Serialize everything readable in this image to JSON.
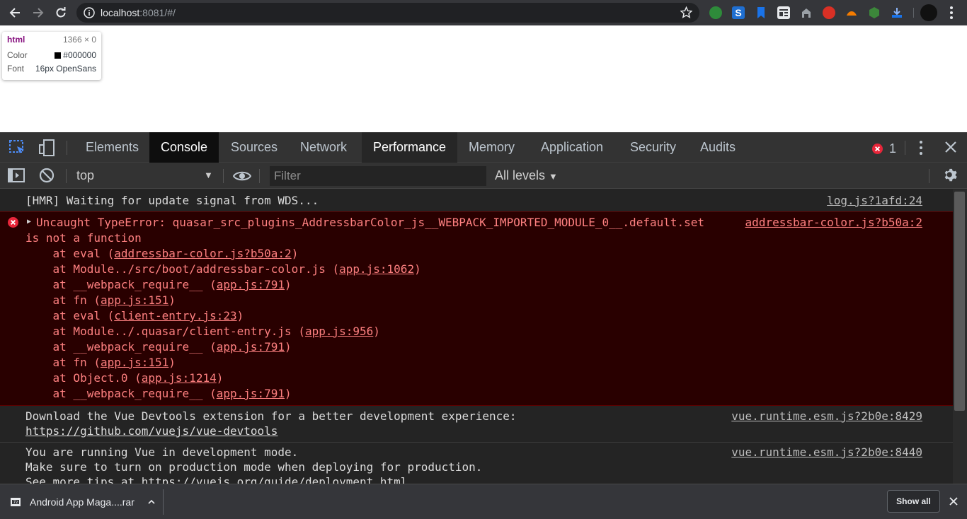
{
  "browser": {
    "url_host": "localhost",
    "url_rest": ":8081/#/"
  },
  "tooltip": {
    "tag": "html",
    "size": "1366 × 0",
    "color_label": "Color",
    "color_value": "#000000",
    "font_label": "Font",
    "font_value": "16px OpenSans"
  },
  "devtools": {
    "tabs": [
      "Elements",
      "Console",
      "Sources",
      "Network",
      "Performance",
      "Memory",
      "Application",
      "Security",
      "Audits"
    ],
    "error_count": "1",
    "context": "top",
    "filter_placeholder": "Filter",
    "levels": "All levels"
  },
  "console": {
    "hmr": {
      "text": "[HMR] Waiting for update signal from WDS...",
      "source": "log.js?1afd:24"
    },
    "error": {
      "line1": "Uncaught TypeError: quasar_src_plugins_AddressbarColor_js__WEBPACK_IMPORTED_MODULE_0__.default.set",
      "line2": "is not a function",
      "source": "addressbar-color.js?b50a:2",
      "frames": [
        {
          "pre": "    at eval (",
          "link": "addressbar-color.js?b50a:2",
          "post": ")"
        },
        {
          "pre": "    at Module../src/boot/addressbar-color.js (",
          "link": "app.js:1062",
          "post": ")"
        },
        {
          "pre": "    at __webpack_require__ (",
          "link": "app.js:791",
          "post": ")"
        },
        {
          "pre": "    at fn (",
          "link": "app.js:151",
          "post": ")"
        },
        {
          "pre": "    at eval (",
          "link": "client-entry.js:23",
          "post": ")"
        },
        {
          "pre": "    at Module../.quasar/client-entry.js (",
          "link": "app.js:956",
          "post": ")"
        },
        {
          "pre": "    at __webpack_require__ (",
          "link": "app.js:791",
          "post": ")"
        },
        {
          "pre": "    at fn (",
          "link": "app.js:151",
          "post": ")"
        },
        {
          "pre": "    at Object.0 (",
          "link": "app.js:1214",
          "post": ")"
        },
        {
          "pre": "    at __webpack_require__ (",
          "link": "app.js:791",
          "post": ")"
        }
      ]
    },
    "devtools_msg": {
      "line1": "Download the Vue Devtools extension for a better development experience:",
      "link": "https://github.com/vuejs/vue-devtools",
      "source": "vue.runtime.esm.js?2b0e:8429"
    },
    "devmode_msg": {
      "line1": "You are running Vue in development mode.",
      "line2": "Make sure to turn on production mode when deploying for production.",
      "line3": "See more tips at https://vuejs.org/guide/deployment.html",
      "source": "vue.runtime.esm.js?2b0e:8440"
    }
  },
  "downloads": {
    "file_name": "Android App Maga....rar",
    "show_all": "Show all"
  }
}
